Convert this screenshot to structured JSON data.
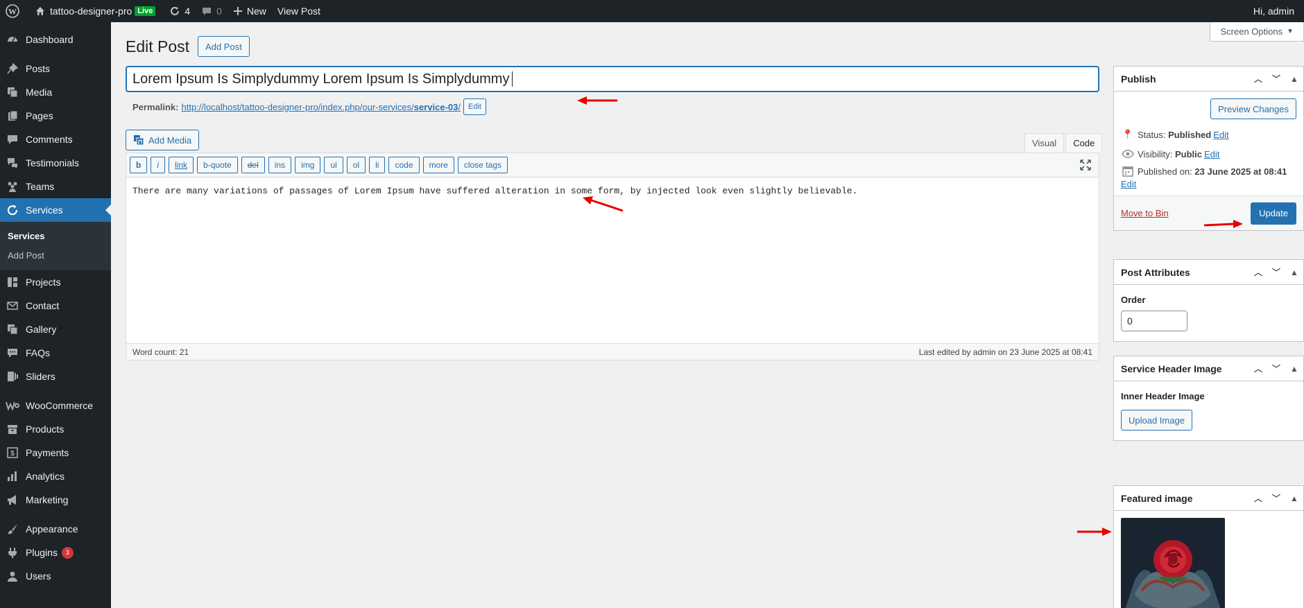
{
  "adminbar": {
    "site_name": "tattoo-designer-pro",
    "live_badge": "Live",
    "updates_count": "4",
    "comments_count": "0",
    "new_label": "New",
    "view_post_label": "View Post",
    "greeting": "Hi, admin"
  },
  "sidebar": {
    "items": [
      {
        "label": "Dashboard",
        "icon": "dashboard-icon"
      },
      {
        "label": "Posts",
        "icon": "pin-icon"
      },
      {
        "label": "Media",
        "icon": "media-icon"
      },
      {
        "label": "Pages",
        "icon": "page-icon"
      },
      {
        "label": "Comments",
        "icon": "comment-icon"
      },
      {
        "label": "Testimonials",
        "icon": "testimonial-icon"
      },
      {
        "label": "Teams",
        "icon": "groups-icon"
      },
      {
        "label": "Services",
        "icon": "services-icon"
      },
      {
        "label": "Projects",
        "icon": "projects-icon"
      },
      {
        "label": "Contact",
        "icon": "email-icon"
      },
      {
        "label": "Gallery",
        "icon": "gallery-icon"
      },
      {
        "label": "FAQs",
        "icon": "faq-icon"
      },
      {
        "label": "Sliders",
        "icon": "sliders-icon"
      },
      {
        "label": "WooCommerce",
        "icon": "woo-icon"
      },
      {
        "label": "Products",
        "icon": "archive-icon"
      },
      {
        "label": "Payments",
        "icon": "money-icon"
      },
      {
        "label": "Analytics",
        "icon": "chart-icon"
      },
      {
        "label": "Marketing",
        "icon": "megaphone-icon"
      },
      {
        "label": "Appearance",
        "icon": "brush-icon"
      },
      {
        "label": "Plugins",
        "icon": "plugin-icon",
        "badge": "3"
      },
      {
        "label": "Users",
        "icon": "users-icon"
      }
    ],
    "submenu": [
      "Services",
      "Add Post"
    ]
  },
  "main": {
    "screen_options": "Screen Options",
    "page_title": "Edit Post",
    "add_post_label": "Add Post",
    "post_title": "Lorem Ipsum Is Simplydummy Lorem Ipsum Is Simplydummy",
    "permalink_label": "Permalink:",
    "permalink_base": "http://localhost/tattoo-designer-pro/index.php/our-services/",
    "permalink_slug": "service-03",
    "permalink_tail": "/",
    "permalink_edit": "Edit",
    "add_media_label": "Add Media",
    "tab_visual": "Visual",
    "tab_code": "Code",
    "quicktags": [
      "b",
      "i",
      "link",
      "b-quote",
      "del",
      "ins",
      "img",
      "ul",
      "ol",
      "li",
      "code",
      "more",
      "close tags"
    ],
    "content": "There are many variations of passages of Lorem Ipsum have suffered alteration in some form, by injected look even slightly believable.",
    "word_count": "Word count: 21",
    "last_edited": "Last edited by admin on 23 June 2025 at 08:41"
  },
  "publish": {
    "title": "Publish",
    "preview_label": "Preview Changes",
    "status_label": "Status:",
    "status_value": "Published",
    "visibility_label": "Visibility:",
    "visibility_value": "Public",
    "published_label": "Published on:",
    "published_value": "23 June 2025 at 08:41",
    "edit_label": "Edit",
    "trash_label": "Move to Bin",
    "update_label": "Update"
  },
  "attributes": {
    "title": "Post Attributes",
    "order_label": "Order",
    "order_value": "0"
  },
  "header_image": {
    "title": "Service Header Image",
    "inner_label": "Inner Header Image",
    "upload_label": "Upload Image"
  },
  "featured": {
    "title": "Featured image"
  },
  "colors": {
    "accent": "#2271b1",
    "sidebar": "#1d2327",
    "annotation_arrow": "#e60000"
  }
}
